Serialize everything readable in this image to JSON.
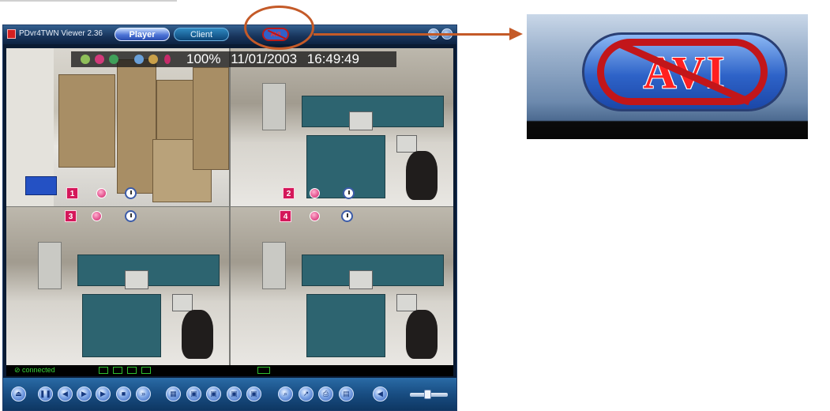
{
  "window": {
    "title": "PDvr4TWN Viewer 2.36",
    "tabs": [
      {
        "label": "Player"
      },
      {
        "label": "Client"
      }
    ],
    "record_button": {
      "label": "AVI",
      "icon": "avi-disabled-icon"
    }
  },
  "osd": {
    "zoom": "100%",
    "date": "11/01/2003",
    "time": "16:49:49",
    "icons": [
      "camera-icon",
      "record-icon",
      "alarm-icon",
      "network-icon",
      "motion-icon",
      "disk-icon"
    ]
  },
  "cameras": [
    {
      "number": "1",
      "scene": "warehouse"
    },
    {
      "number": "2",
      "scene": "office"
    },
    {
      "number": "3",
      "scene": "office"
    },
    {
      "number": "4",
      "scene": "office"
    }
  ],
  "status": {
    "text": "connected",
    "channel_indicators": 4
  },
  "toolbar": {
    "buttons": [
      "eject-icon",
      "pause-icon",
      "step-back-icon",
      "play-icon",
      "step-forward-icon",
      "stop-icon",
      "fast-forward-icon",
      "grid-icon",
      "camera1-icon",
      "camera2-icon",
      "camera3-icon",
      "camera4-icon",
      "search-icon",
      "export-icon",
      "print-icon",
      "backup-icon",
      "speaker-icon"
    ]
  },
  "zoom": {
    "label": "AVI"
  },
  "colors": {
    "annotation": "#c45a28",
    "window_bg": "#0a1b33",
    "status_text": "#38d238",
    "avi_red": "#c2161a"
  }
}
